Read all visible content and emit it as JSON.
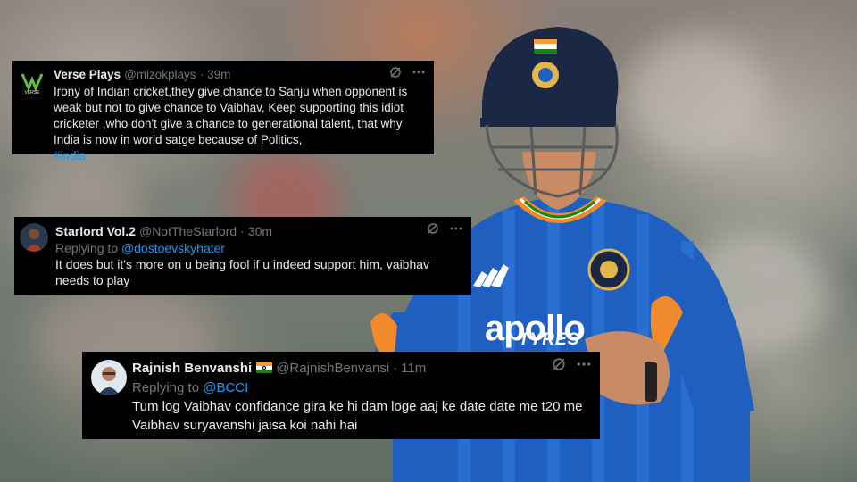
{
  "tweets": [
    {
      "name": "Verse Plays",
      "handle": "@mizokplays",
      "separator": "·",
      "time": "39m",
      "avatar_text": "VERSE",
      "text": "Irony of Indian cricket,they give chance to Sanju when opponent is weak but not to give chance to Vaibhav, Keep supporting this idiot cricketer ,who don't give a chance to generational talent, that why India is now in world satge because of Politics,",
      "hashtag": "#india"
    },
    {
      "name": "Starlord Vol.2",
      "handle": "@NotTheStarlord",
      "separator": "·",
      "time": "30m",
      "replying_prefix": "Replying to",
      "replying_to": "@dostoevskyhater",
      "text": "It does but it's more on u being fool if u indeed support him, vaibhav needs to play"
    },
    {
      "name": "Rajnish Benvanshi",
      "handle": "@RajnishBenvansi",
      "separator": "·",
      "time": "11m",
      "replying_prefix": "Replying to",
      "replying_to": "@BCCI",
      "text": "Tum log Vaibhav confidance gira ke hi dam loge aaj ke date date me t20 me Vaibhav suryavanshi jaisa koi nahi hai"
    }
  ],
  "icons": {
    "grok": "grok-icon",
    "more": "more-icon",
    "flag": "india-flag-icon"
  },
  "jersey": {
    "sponsor": "apollo",
    "sponsor_sub": "TYRES"
  },
  "colors": {
    "tweet_bg": "#000000",
    "text": "#e7e9ea",
    "muted": "#71767b",
    "link": "#1d9bf0",
    "jersey_blue": "#1f5fbf",
    "jersey_orange": "#f08a2c"
  }
}
